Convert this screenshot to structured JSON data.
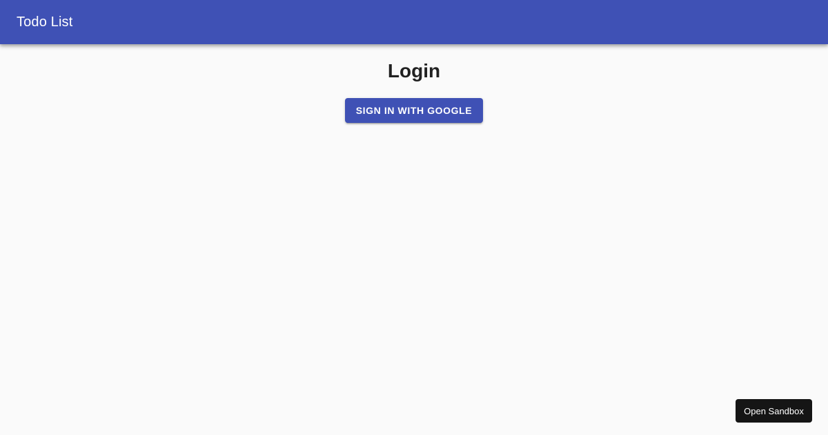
{
  "app_bar": {
    "title": "Todo List",
    "background": "#3f51b5"
  },
  "main": {
    "title": "Login",
    "sign_in_button": {
      "label": "Sign in with Google",
      "background": "#3f51b5"
    }
  },
  "sandbox": {
    "label": "Open Sandbox",
    "background": "#151515"
  }
}
